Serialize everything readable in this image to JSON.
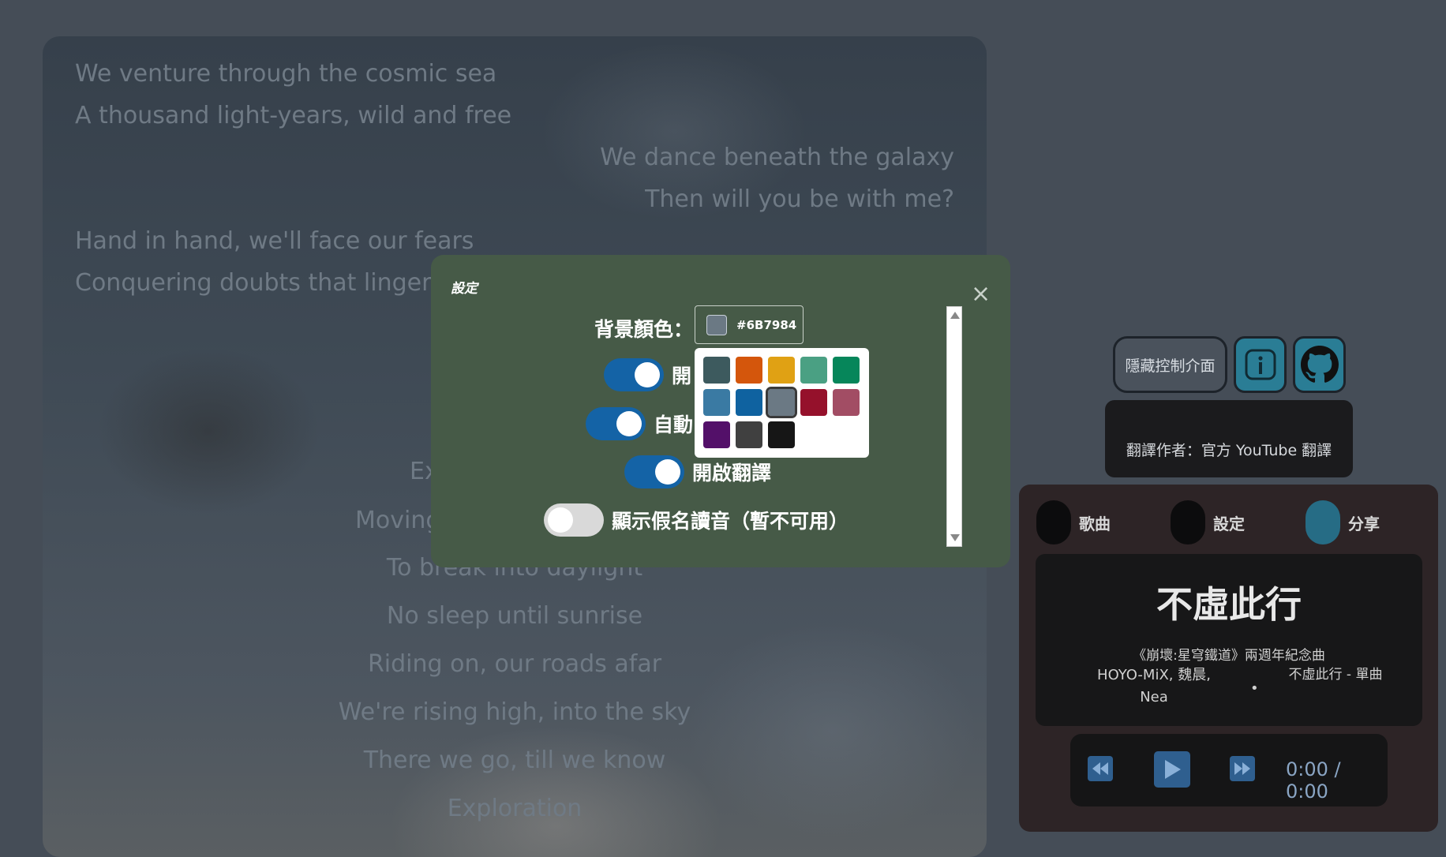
{
  "lyrics": [
    {
      "text": "We venture through the cosmic sea",
      "align": "left"
    },
    {
      "text": "A thousand light-years, wild and free",
      "align": "left"
    },
    {
      "text": "We dance beneath the galaxy",
      "align": "right"
    },
    {
      "text": "Then will you be with me?",
      "align": "right"
    },
    {
      "text": "Hand in hand, we'll face our fears",
      "align": "left"
    },
    {
      "text": "Conquering doubts that linger ne",
      "align": "left"
    },
    {
      "text": "Ex",
      "align": "center"
    },
    {
      "text": "Moving",
      "align": "center"
    },
    {
      "text": "To break into daylight",
      "align": "center"
    },
    {
      "text": "No sleep until sunrise",
      "align": "center"
    },
    {
      "text": "Riding on, our roads afar",
      "align": "center"
    },
    {
      "text": "We're rising high, into the sky",
      "align": "center"
    },
    {
      "text": "There we go, till we know",
      "align": "center"
    },
    {
      "text": "Exploration",
      "align": "center"
    }
  ],
  "controls": {
    "hide_label": "隱藏控制介面",
    "info_icon": "info-icon",
    "github_icon": "github-icon",
    "translator": "翻譯作者：官方 YouTube 翻譯"
  },
  "player": {
    "tabs": [
      {
        "label": "歌曲",
        "active": false
      },
      {
        "label": "設定",
        "active": false
      },
      {
        "label": "分享",
        "active": true
      }
    ],
    "title": "不虛此行",
    "subtitle": "《崩壞:星穹鐵道》兩週年紀念曲",
    "artist": "HOYO-MiX, 魏晨, Nea",
    "separator": "•",
    "album": "不虛此行 - 單曲",
    "time": "0:00 / 0:00"
  },
  "modal": {
    "title": "設定",
    "close": "×",
    "bg_color_label": "背景顏色：",
    "bg_color_value": "#6B7984",
    "toggles": [
      {
        "label": "開",
        "on": true
      },
      {
        "label": "自動",
        "on": true
      },
      {
        "label": "開啟翻譯",
        "on": true
      },
      {
        "label": "顯示假名讀音（暫不可用）",
        "on": false
      }
    ],
    "palette": [
      "#3d5a5e",
      "#d4560c",
      "#e0a114",
      "#4aa083",
      "#06865a",
      "#3a7aa3",
      "#0f62a0",
      "#6b7984",
      "#95112b",
      "#a24d64",
      "#531069",
      "#404040",
      "#161616"
    ],
    "palette_selected": "#6b7984"
  }
}
